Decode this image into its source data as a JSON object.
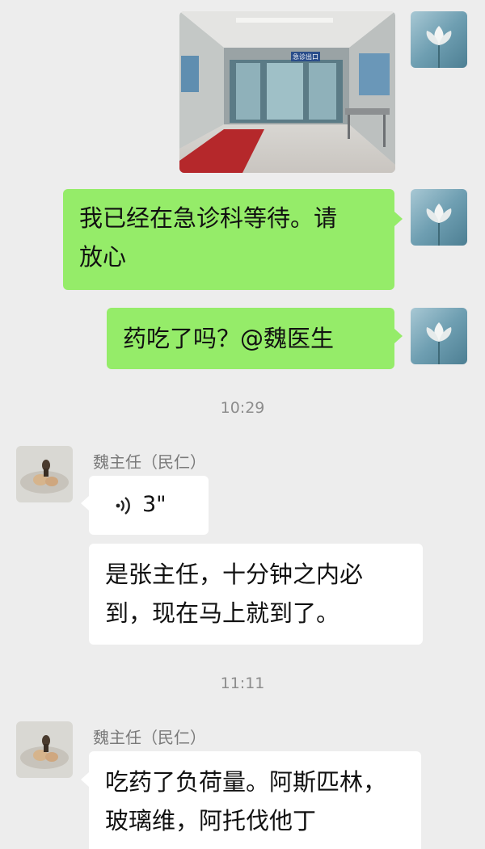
{
  "chat": {
    "messages": [
      {
        "type": "image",
        "from": "self",
        "alt": "hospital-emergency-entrance-photo"
      },
      {
        "type": "text",
        "from": "self",
        "text_line1": "我已经在急诊科等待。请",
        "text_line2": "放心"
      },
      {
        "type": "text",
        "from": "self",
        "text": "药吃了吗？@魏医生"
      }
    ],
    "timestamp_1": "10:29",
    "sender_name": "魏主任（民仁）",
    "voice": {
      "duration": "3\"",
      "icon": "voice-wave-icon"
    },
    "reply_1": {
      "line1": "是张主任，十分钟之内必",
      "line2": "到，现在马上就到了。"
    },
    "timestamp_2": "11:11",
    "sender_name_2": "魏主任（民仁）",
    "reply_2": {
      "line1": "吃药了负荷量。阿斯匹林，",
      "line2": "玻璃维，阿托伐他丁"
    },
    "photo_sign_text": "急诊出口"
  },
  "colors": {
    "background": "#ededed",
    "self_bubble": "#95ec69",
    "other_bubble": "#ffffff",
    "timestamp": "#8d8d8d"
  }
}
